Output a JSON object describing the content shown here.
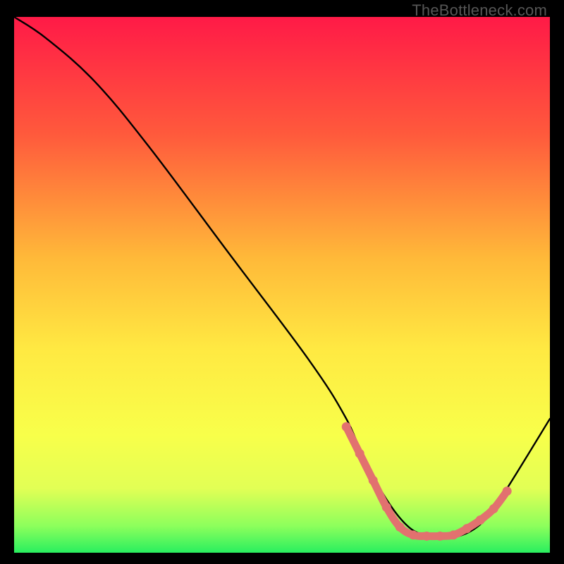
{
  "watermark": "TheBottleneck.com",
  "chart_data": {
    "type": "line",
    "title": "",
    "xlabel": "",
    "ylabel": "",
    "xlim": [
      0,
      100
    ],
    "ylim": [
      0,
      100
    ],
    "grid": false,
    "legend": false,
    "gradient_stops": [
      {
        "offset": 0,
        "color": "#ff1a47"
      },
      {
        "offset": 0.22,
        "color": "#ff5a3c"
      },
      {
        "offset": 0.45,
        "color": "#ffb939"
      },
      {
        "offset": 0.62,
        "color": "#ffe942"
      },
      {
        "offset": 0.78,
        "color": "#f8ff4a"
      },
      {
        "offset": 0.88,
        "color": "#e2ff55"
      },
      {
        "offset": 0.95,
        "color": "#8dff5c"
      },
      {
        "offset": 1.0,
        "color": "#29ef5f"
      }
    ],
    "series": [
      {
        "name": "bottleneck-curve",
        "x": [
          0,
          6,
          15,
          25,
          40,
          55,
          62,
          66,
          72,
          77,
          83,
          88,
          92,
          100
        ],
        "y": [
          100,
          96,
          88,
          76,
          56,
          36,
          25,
          16,
          6.5,
          3.1,
          3.1,
          6.2,
          12,
          25
        ]
      }
    ],
    "highlight_band": {
      "name": "optimal-range",
      "color": "#e2716f",
      "x": [
        62,
        64.5,
        67,
        69.5,
        72,
        74.5,
        77,
        79.5,
        82,
        84.5,
        87,
        89.5,
        92
      ],
      "y": [
        23.5,
        18.5,
        13.5,
        8.5,
        4.8,
        3.3,
        3.1,
        3.1,
        3.3,
        4.5,
        6.1,
        8.2,
        11.5
      ]
    }
  }
}
